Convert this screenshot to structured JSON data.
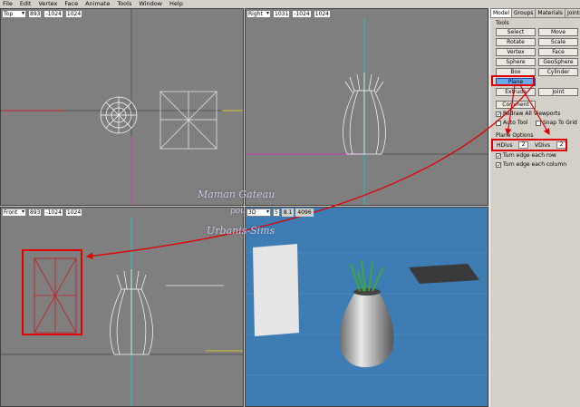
{
  "menu": [
    "File",
    "Edit",
    "Vertex",
    "Face",
    "Animate",
    "Tools",
    "Window",
    "Help"
  ],
  "viewports": {
    "top": {
      "view": "Top",
      "c1": "893",
      "c2": "-1024",
      "c3": "1024"
    },
    "right": {
      "view": "Right",
      "c1": "1031",
      "c2": "-1024",
      "c3": "1024"
    },
    "front": {
      "view": "Front",
      "c1": "893",
      "c2": "-1024",
      "c3": "1024"
    },
    "p3d": {
      "view": "3D",
      "c1": "5",
      "c2": "8.1",
      "c3": "4096"
    }
  },
  "panel": {
    "tabs": [
      "Model",
      "Groups",
      "Materials",
      "Joints"
    ],
    "tools_label": "Tools",
    "buttons": [
      "Select",
      "Move",
      "Rotate",
      "Scale",
      "Vertex",
      "Face",
      "Sphere",
      "GeoSphere",
      "Box",
      "Cylinder",
      "Plane",
      "Extrude",
      "Joint",
      "Comment"
    ],
    "checks": [
      {
        "label": "Redraw All Viewports",
        "checked": true
      },
      {
        "label": "Auto Tool",
        "checked": false
      },
      {
        "label": "Snap To Grid",
        "checked": false
      }
    ],
    "options_label": "Plane Options",
    "hdiv_label": "HDivs",
    "hdiv_value": "2",
    "vdiv_label": "VDivs",
    "vdiv_value": "2",
    "turn_row": "Turn edge each row",
    "turn_col": "Turn edge each column"
  },
  "watermark": {
    "line1": "Maman Gateau",
    "line2": "pour",
    "line3": "Urbanis-Sims"
  },
  "colors": {
    "highlight": "#e00000",
    "viewport": "#7f7f7f",
    "view3d": "#3e7cb4"
  }
}
